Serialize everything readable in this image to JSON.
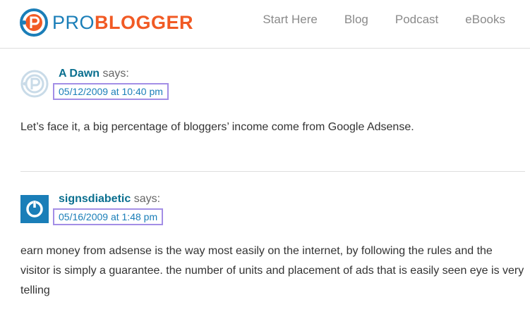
{
  "site": {
    "logo_pro": "PRO",
    "logo_blogger": "BLOGGER",
    "brand_blue": "#1a7eb8",
    "brand_orange": "#f15a24"
  },
  "nav": {
    "items": [
      {
        "label": "Start Here"
      },
      {
        "label": "Blog"
      },
      {
        "label": "Podcast"
      },
      {
        "label": "eBooks"
      }
    ]
  },
  "comments": [
    {
      "author": "A Dawn",
      "says": "says:",
      "date": "05/12/2009 at 10:40 pm",
      "avatar_icon": "problogger-default-avatar-icon",
      "text": "Let’s face it, a big percentage of bloggers’ income come from Google Adsense."
    },
    {
      "author": "signsdiabetic",
      "says": "says:",
      "date": "05/16/2009 at 1:48 pm",
      "avatar_icon": "power-symbol-avatar-icon",
      "text": "earn money from adsense is the way most easily on the internet, by following the rules and the visitor is simply a guarantee. the number of units and placement of ads that is easily seen eye is very telling"
    }
  ],
  "highlight_color": "#a38ee6"
}
